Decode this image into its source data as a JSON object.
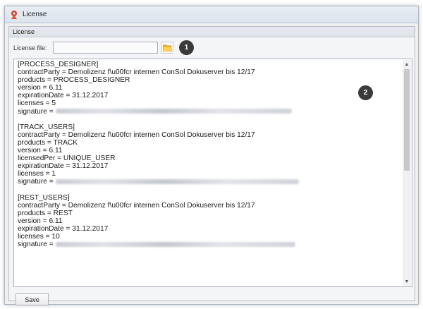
{
  "window": {
    "title": "License"
  },
  "panel": {
    "header": "License"
  },
  "file": {
    "label": "License file:",
    "value": "",
    "placeholder": ""
  },
  "badges": {
    "b1": "1",
    "b2": "2"
  },
  "license_text": {
    "process": {
      "header": "[PROCESS_DESIGNER]",
      "contract": "contractParty = Demolizenz f\\u00fcr internen ConSol Dokuserver bis 12/17",
      "products": "products = PROCESS_DESIGNER",
      "version": "version = 6.11",
      "expiration": "expirationDate = 31.12.2017",
      "licenses": "licenses = 5",
      "signature": "signature ="
    },
    "track": {
      "header": "[TRACK_USERS]",
      "contract": "contractParty = Demolizenz f\\u00fcr internen ConSol Dokuserver bis 12/17",
      "products": "products = TRACK",
      "version": "version = 6.11",
      "licensed_per": "licensedPer = UNIQUE_USER",
      "expiration": "expirationDate = 31.12.2017",
      "licenses": "licenses = 1",
      "signature": "signature ="
    },
    "rest": {
      "header": "[REST_USERS]",
      "contract": "contractParty = Demolizenz f\\u00fcr internen ConSol Dokuserver bis 12/17",
      "products": "products = REST",
      "version": "version = 6.11",
      "expiration": "expirationDate = 31.12.2017",
      "licenses": "licenses = 10",
      "signature": "signature ="
    }
  },
  "actions": {
    "save": "Save"
  },
  "icons": {
    "app": "consol-app-icon",
    "folder": "folder-icon"
  }
}
